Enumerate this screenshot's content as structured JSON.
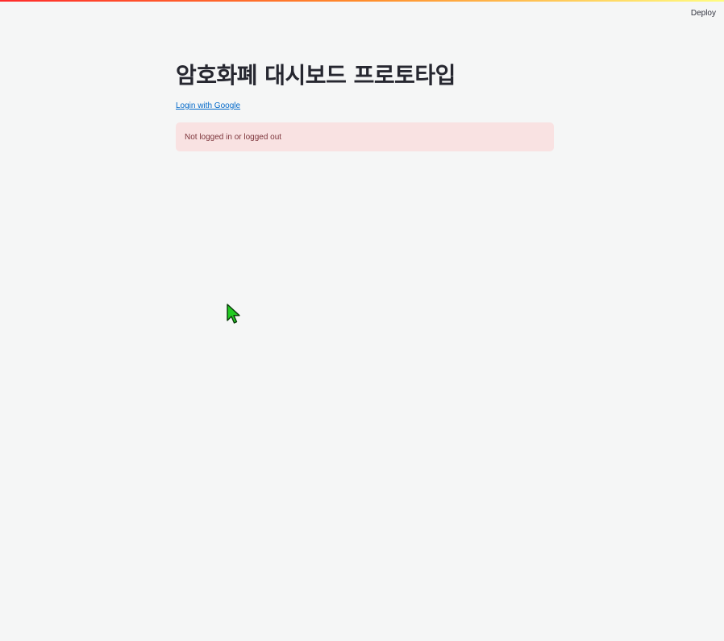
{
  "header": {
    "deploy_label": "Deploy"
  },
  "main": {
    "title": "암호화폐 대시보드 프로토타입",
    "login_link": "Login with Google",
    "alert_text": "Not logged in or logged out"
  },
  "colors": {
    "background": "#f5f6f6",
    "link": "#0068c9",
    "alert_background": "#f9e2e2",
    "alert_text": "#7d353b",
    "cursor": "#22cc22"
  },
  "icons": {
    "cursor": "mouse-pointer-icon"
  }
}
